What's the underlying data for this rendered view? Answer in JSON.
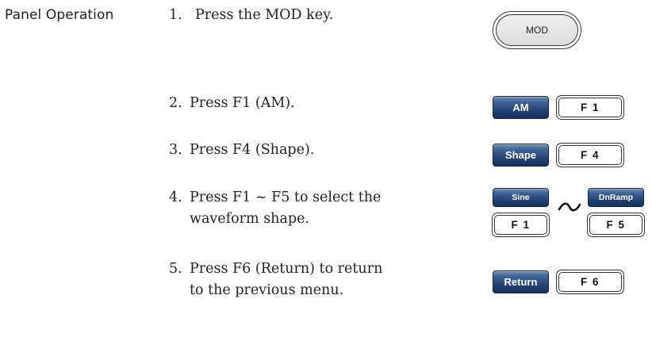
{
  "section_label": "Panel Operation",
  "steps": [
    {
      "num": "1.",
      "lines": [
        "Press the MOD key."
      ]
    },
    {
      "num": "2.",
      "lines": [
        "Press F1 (AM)."
      ]
    },
    {
      "num": "3.",
      "lines": [
        "Press F4 (Shape)."
      ]
    },
    {
      "num": "4.",
      "lines": [
        "Press F1 ~ F5 to select the",
        "waveform shape."
      ]
    },
    {
      "num": "5.",
      "lines": [
        "Press F6 (Return) to return",
        "to the previous menu."
      ]
    }
  ],
  "keys": {
    "mod": "MOD",
    "am": "AM",
    "f1": "F 1",
    "shape": "Shape",
    "f4": "F 4",
    "sine": "Sine",
    "dnramp": "DnRamp",
    "f5": "F 5",
    "return": "Return",
    "f6": "F 6"
  },
  "icons": {
    "range_separator": "tilde-icon"
  },
  "colors": {
    "softkey_top": "#6c8bb8",
    "softkey_bottom": "#16305a",
    "outline": "#333333",
    "text": "#222222"
  }
}
